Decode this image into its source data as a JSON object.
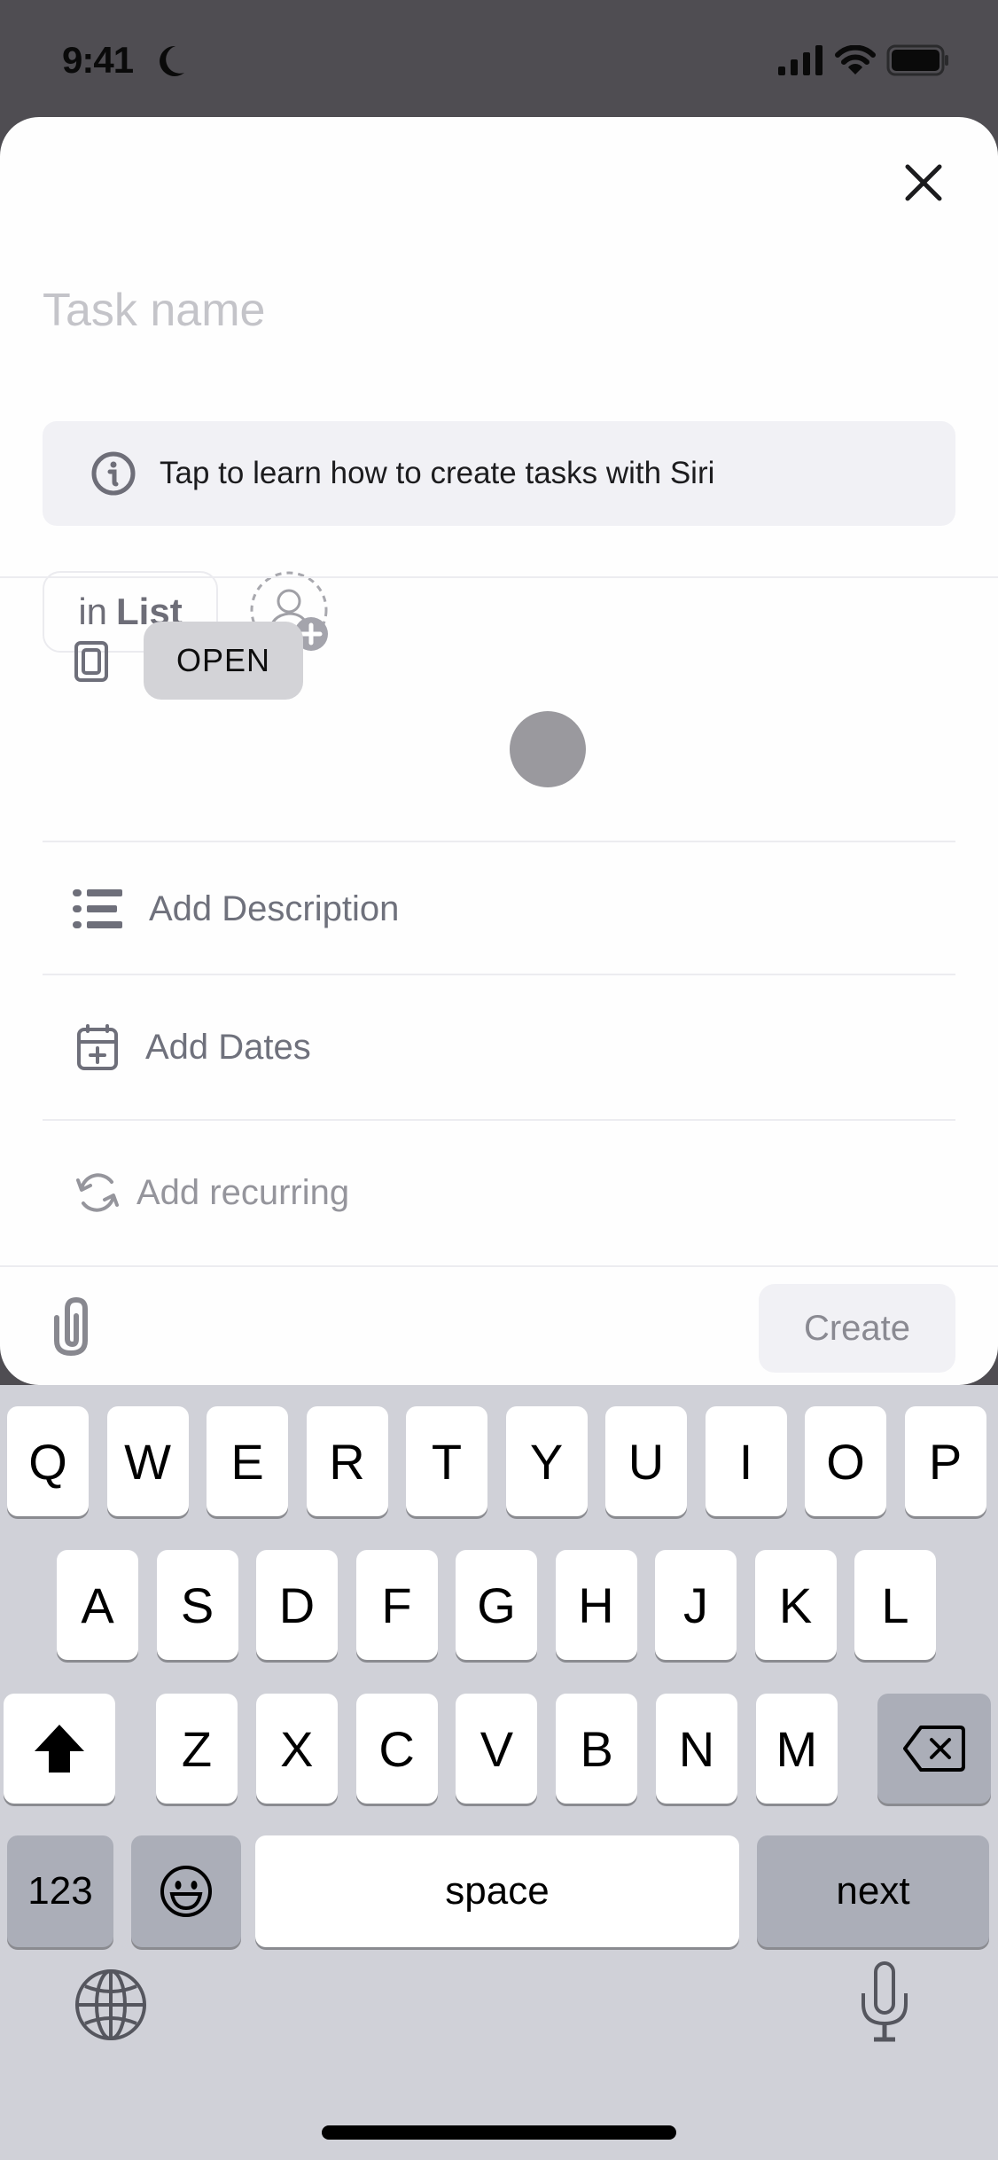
{
  "status_bar": {
    "time": "9:41",
    "focus_icon": "moon-icon",
    "signal_icon": "cellular-signal-icon",
    "wifi_icon": "wifi-icon",
    "battery_icon": "battery-icon"
  },
  "sheet": {
    "close_icon": "close-icon",
    "task_name": {
      "value": "",
      "placeholder": "Task name"
    },
    "siri_banner": {
      "icon": "info-icon",
      "text": "Tap to learn how to create tasks with Siri"
    },
    "list_chip": {
      "prefix": "in",
      "name": "List"
    },
    "assignee_icon": "add-assignee-icon",
    "status": {
      "icon": "status-square-icon",
      "label": "OPEN"
    },
    "rows": [
      {
        "icon": "description-list-icon",
        "label": "Add Description"
      },
      {
        "icon": "calendar-plus-icon",
        "label": "Add Dates"
      },
      {
        "icon": "recurring-icon",
        "label": "Add recurring"
      }
    ],
    "footer": {
      "attach_icon": "paperclip-icon",
      "create_label": "Create"
    }
  },
  "keyboard": {
    "row1": [
      "Q",
      "W",
      "E",
      "R",
      "T",
      "Y",
      "U",
      "I",
      "O",
      "P"
    ],
    "row2": [
      "A",
      "S",
      "D",
      "F",
      "G",
      "H",
      "J",
      "K",
      "L"
    ],
    "row3": [
      "Z",
      "X",
      "C",
      "V",
      "B",
      "N",
      "M"
    ],
    "shift_icon": "shift-icon",
    "delete_icon": "backspace-icon",
    "numbers_label": "123",
    "emoji_icon": "emoji-icon",
    "space_label": "space",
    "return_label": "next",
    "globe_icon": "globe-icon",
    "mic_icon": "microphone-icon"
  },
  "colors": {
    "sheet_bg": "#fefefe",
    "backdrop": "#4f4d52",
    "keyboard_bg": "#d0d1d8",
    "open_badge": "#d3d3d7",
    "muted_text": "#6f717c"
  }
}
